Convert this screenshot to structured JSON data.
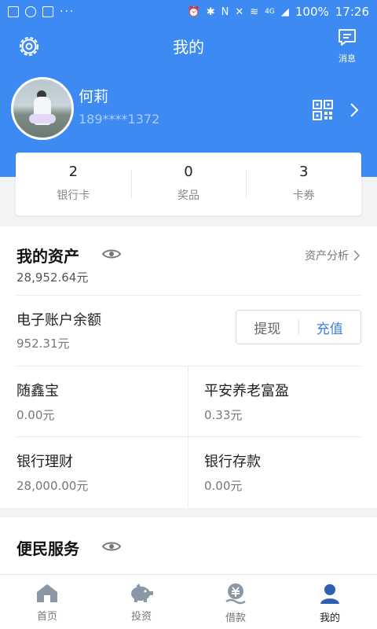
{
  "status_bar": {
    "battery": "100%",
    "time": "17:26",
    "dots": "···",
    "network": "4G"
  },
  "header": {
    "title": "我的",
    "message_label": "消息"
  },
  "user": {
    "name": "何莉",
    "phone": "189****1372"
  },
  "stats": [
    {
      "value": "2",
      "label": "银行卡"
    },
    {
      "value": "0",
      "label": "奖品"
    },
    {
      "value": "3",
      "label": "卡券"
    }
  ],
  "assets": {
    "title": "我的资产",
    "total": "28,952.64元",
    "analysis_link": "资产分析",
    "e_account": {
      "label": "电子账户余额",
      "value": "952.31元",
      "withdraw": "提现",
      "recharge": "充值"
    },
    "grid": [
      {
        "label": "随鑫宝",
        "value": "0.00元"
      },
      {
        "label": "平安养老富盈",
        "value": "0.33元"
      },
      {
        "label": "银行理财",
        "value": "28,000.00元"
      },
      {
        "label": "银行存款",
        "value": "0.00元"
      }
    ]
  },
  "services": {
    "title": "便民服务"
  },
  "tabbar": [
    {
      "label": "首页",
      "icon": "home-icon"
    },
    {
      "label": "投资",
      "icon": "piggy-bank-icon"
    },
    {
      "label": "借款",
      "icon": "loan-icon"
    },
    {
      "label": "我的",
      "icon": "profile-icon",
      "active": true
    }
  ],
  "colors": {
    "primary": "#3d8bf2",
    "link": "#3d7ee6",
    "active_tab": "#2f5fb0"
  }
}
